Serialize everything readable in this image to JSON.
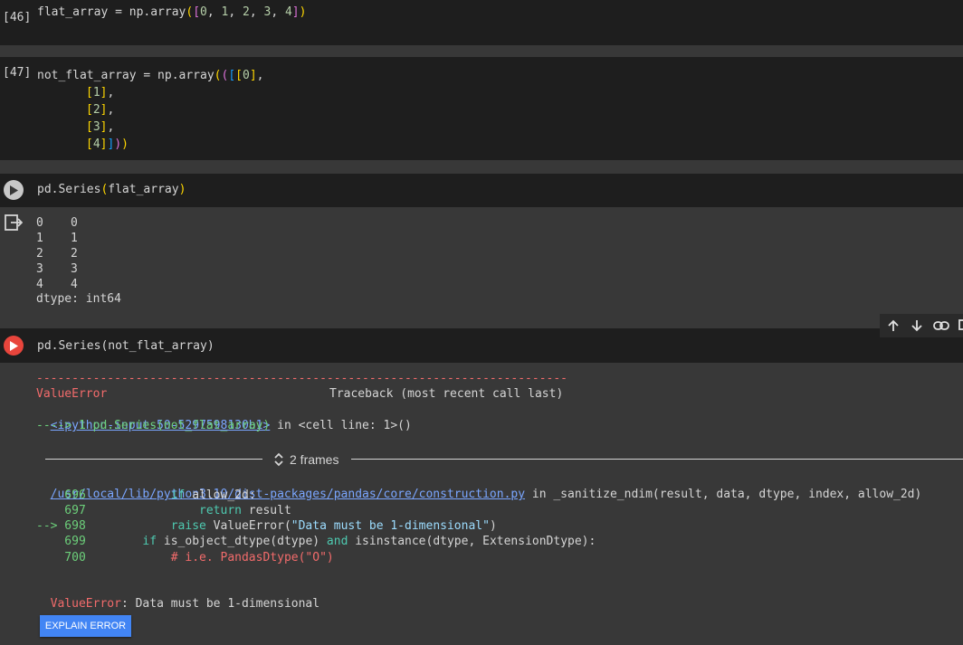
{
  "cells": {
    "c46": {
      "prompt": "[46]",
      "code": "flat_array = np.array([0, 1, 2, 3, 4])"
    },
    "c47": {
      "prompt": "[47]",
      "line1": "not_flat_array = np.array(([[0],",
      "line2": "[1],",
      "line3": "[2],",
      "line4": "[3],",
      "line5": "[4]]))"
    },
    "c48": {
      "code": "pd.Series(flat_array)",
      "output_rows": [
        {
          "index": "0",
          "value": "0"
        },
        {
          "index": "1",
          "value": "1"
        },
        {
          "index": "2",
          "value": "2"
        },
        {
          "index": "3",
          "value": "3"
        },
        {
          "index": "4",
          "value": "4"
        }
      ],
      "dtype": "dtype: int64"
    },
    "c49": {
      "code": "pd.Series(not_flat_array)",
      "traceback": {
        "dashes": "---------------------------------------------------------------------------",
        "error_name": "ValueError",
        "traceback_header": "Traceback (most recent call last)",
        "input_link": "<ipython-input-50-5297598130b1>",
        "in_cell": " in <cell line: 1>()",
        "arrow_line": "----> 1 pd.Series(not_flat_array)",
        "frames_label": "2 frames",
        "file_link": "/usr/local/lib/python3.10/dist-packages/pandas/core/construction.py",
        "file_in": " in _sanitize_ndim(result, data, dtype, index, allow_2d)",
        "src": [
          {
            "no": "    696",
            "text": "            if allow_2d:"
          },
          {
            "no": "    697",
            "text": "                return result"
          },
          {
            "no": "--> 698",
            "text": "            raise ValueError(\"Data must be 1-dimensional\")"
          },
          {
            "no": "    699",
            "text": "        if is_object_dtype(dtype) and isinstance(dtype, ExtensionDtype):"
          },
          {
            "no": "    700",
            "text": "            # i.e. PandasDtype(\"O\")"
          }
        ],
        "final_error_name": "ValueError",
        "final_error_msg": ": Data must be 1-dimensional"
      },
      "explain_button": "EXPLAIN ERROR"
    }
  },
  "icons": [
    "play-icon",
    "output-icon",
    "arrow-up-icon",
    "arrow-down-icon",
    "link-icon",
    "comment-icon",
    "chevron-updown-icon"
  ],
  "colors": {
    "run_error": "#e8453c",
    "explain_bg": "#4285f4",
    "cell_bg": "#1e1e1e",
    "page_bg": "#383838"
  }
}
